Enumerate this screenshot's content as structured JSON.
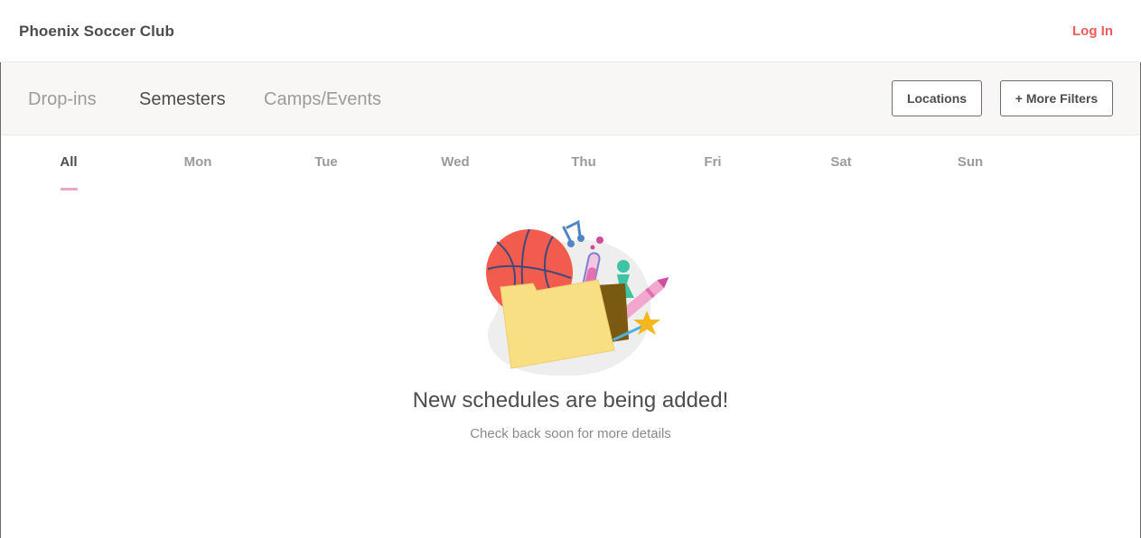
{
  "header": {
    "brand": "Phoenix Soccer Club",
    "login_label": "Log In"
  },
  "nav": {
    "tabs": [
      {
        "label": "Drop-ins",
        "active": false
      },
      {
        "label": "Semesters",
        "active": true
      },
      {
        "label": "Camps/Events",
        "active": false
      }
    ],
    "locations_label": "Locations",
    "more_filters_label": "+ More Filters"
  },
  "days": {
    "items": [
      "All",
      "Mon",
      "Tue",
      "Wed",
      "Thu",
      "Fri",
      "Sat",
      "Sun"
    ],
    "active": "All"
  },
  "empty_state": {
    "title": "New schedules are being added!",
    "subtitle": "Check back soon for more details",
    "illustration_icons": [
      "basketball-icon",
      "folder-icon",
      "music-note-icon",
      "test-tube-icon",
      "chess-pawn-icon",
      "crayon-icon",
      "star-icon"
    ]
  },
  "colors": {
    "accent": "#ef5a5a",
    "active_underline": "#e6a7c9",
    "nav_background": "#f8f7f5"
  }
}
